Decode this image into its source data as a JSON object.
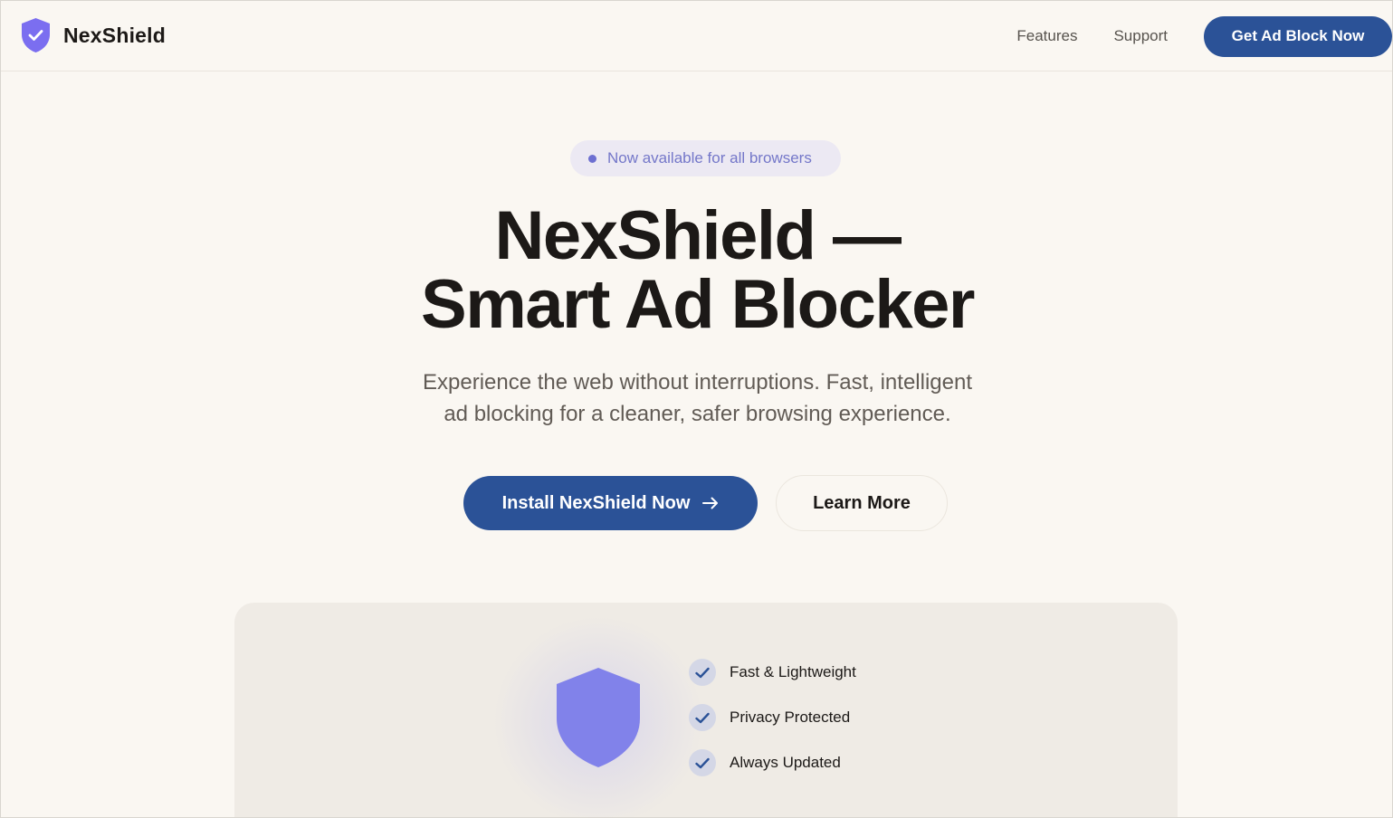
{
  "header": {
    "brand": "NexShield",
    "nav": {
      "features": "Features",
      "support": "Support"
    },
    "cta": "Get Ad Block Now"
  },
  "hero": {
    "badge": "Now available for all browsers",
    "title_line1": "NexShield —",
    "title_line2": "Smart Ad Blocker",
    "subtitle_line1": "Experience the web without interruptions. Fast, intelligent",
    "subtitle_line2": "ad blocking for a cleaner, safer browsing experience.",
    "primary_button": "Install NexShield Now",
    "secondary_button": "Learn More"
  },
  "features": [
    {
      "label": "Fast & Lightweight",
      "icon": "check-icon"
    },
    {
      "label": "Privacy Protected",
      "icon": "check-icon"
    },
    {
      "label": "Always Updated",
      "icon": "check-icon"
    }
  ],
  "colors": {
    "background": "#faf7f2",
    "primary": "#2b5297",
    "brand_purple": "#7b6ef0",
    "shield": "#8182ea",
    "badge_bg": "#ece9f3",
    "badge_text": "#7477c9",
    "card_bg": "#efebe5"
  }
}
